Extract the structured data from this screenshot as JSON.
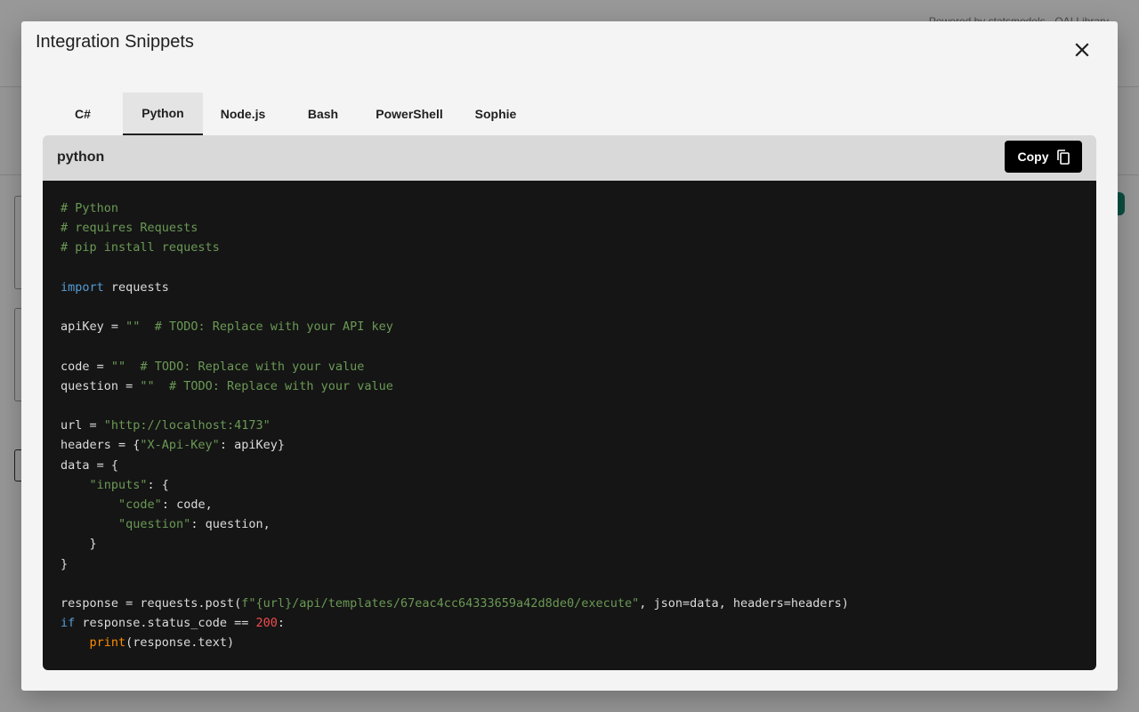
{
  "background": {
    "powered_by": "Powered by statsmodels · QAI Library"
  },
  "modal": {
    "title": "Integration Snippets",
    "close_icon": "close-icon",
    "tabs": [
      {
        "label": "C#",
        "active": false
      },
      {
        "label": "Python",
        "active": true
      },
      {
        "label": "Node.js",
        "active": false
      },
      {
        "label": "Bash",
        "active": false
      },
      {
        "label": "PowerShell",
        "active": false
      },
      {
        "label": "Sophie",
        "active": false
      }
    ],
    "code_block": {
      "language": "python",
      "copy_label": "Copy",
      "copy_icon": "copy-icon",
      "lines": [
        "# Python",
        "# requires Requests",
        "# pip install requests",
        "",
        "import requests",
        "",
        "apiKey = \"\"  # TODO: Replace with your API key",
        "",
        "code = \"\"  # TODO: Replace with your value",
        "question = \"\"  # TODO: Replace with your value",
        "",
        "url = \"http://localhost:4173\"",
        "headers = {\"X-Api-Key\": apiKey}",
        "data = {",
        "    \"inputs\": {",
        "        \"code\": code,",
        "        \"question\": question,",
        "    }",
        "}",
        "",
        "response = requests.post(f\"{url}/api/templates/67eac4cc64333659a42d8de0/execute\", json=data, headers=headers)",
        "if response.status_code == 200:",
        "    print(response.text)"
      ]
    }
  },
  "colors": {
    "code_background": "#151515",
    "code_header": "#d9d9d9",
    "comment": "#6a9955",
    "string": "#6a9955",
    "keyword": "#569cd6",
    "number": "#f14c4c",
    "builtin": "#ff8c00"
  }
}
